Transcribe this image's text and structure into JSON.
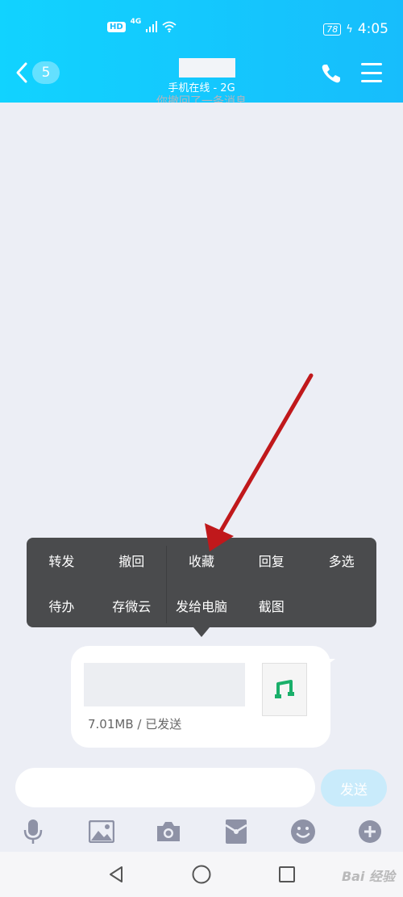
{
  "status_bar": {
    "hd": "HD",
    "network": "4G",
    "battery": "78",
    "time": "4:05"
  },
  "header": {
    "unread_count": "5",
    "subtitle": "手机在线 - 2G"
  },
  "system_message": "你撤回了一条消息",
  "context_menu": {
    "row1": [
      "转发",
      "撤回",
      "收藏",
      "回复",
      "多选"
    ],
    "row2": [
      "待办",
      "存微云",
      "发给电脑",
      "截图"
    ]
  },
  "file_message": {
    "info": "7.01MB / 已发送"
  },
  "input": {
    "placeholder": "",
    "send_label": "发送"
  },
  "toolbar": [
    "mic-icon",
    "image-icon",
    "camera-icon",
    "red-packet-icon",
    "emoji-icon",
    "plus-icon"
  ],
  "watermark": "Bai 经验",
  "colors": {
    "header": "#17bdfc",
    "menu_bg": "#4a4b4d",
    "send_btn": "#c9ebfb",
    "arrow": "#c0181b",
    "music_icon": "#1aaf6a"
  }
}
